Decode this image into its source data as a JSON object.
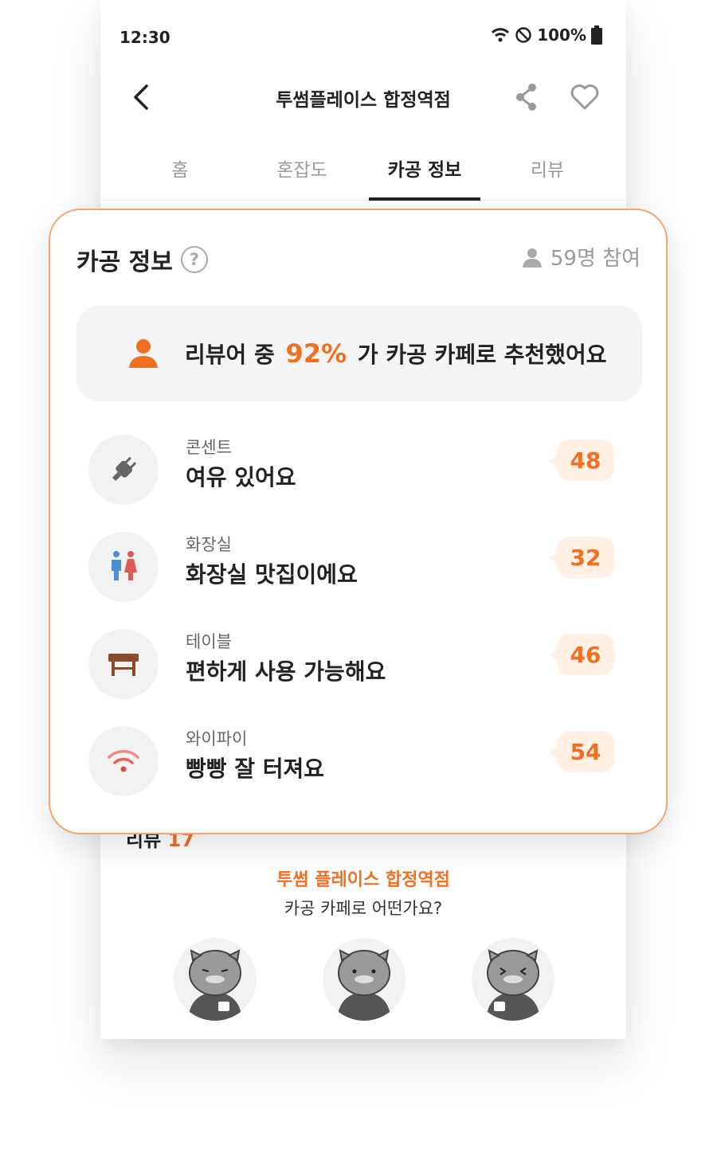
{
  "status": {
    "time": "12:30",
    "battery": "100%"
  },
  "header": {
    "title": "투썸플레이스 합정역점"
  },
  "tabs": [
    {
      "label": "홈",
      "active": false
    },
    {
      "label": "혼잡도",
      "active": false
    },
    {
      "label": "카공 정보",
      "active": true
    },
    {
      "label": "리뷰",
      "active": false
    }
  ],
  "card": {
    "title": "카공 정보",
    "help_icon": "question-circle-icon",
    "participants": "59명 참여",
    "summary": {
      "prefix": "리뷰어 중",
      "percent": "92%",
      "suffix": "가 카공 카페로 추천했어요"
    },
    "items": [
      {
        "category": "콘센트",
        "text": "여유 있어요",
        "count": "48",
        "icon": "plug-icon"
      },
      {
        "category": "화장실",
        "text": "화장실 맛집이에요",
        "count": "32",
        "icon": "restroom-icon"
      },
      {
        "category": "테이블",
        "text": "편하게 사용 가능해요",
        "count": "46",
        "icon": "table-icon"
      },
      {
        "category": "와이파이",
        "text": "빵빵 잘 터져요",
        "count": "54",
        "icon": "wifi-icon"
      }
    ]
  },
  "review_section": {
    "title_peek": "리뷰",
    "count_peek": "17",
    "place": "투썸 플레이스 합정역점",
    "question": "카공 카페로 어떤가요?",
    "options": [
      "thumbs-down-mascot",
      "neutral-mascot",
      "thumbs-up-mascot"
    ]
  },
  "colors": {
    "accent": "#f26f21",
    "card_border": "#f5a46b",
    "count_bg": "#fff0e3"
  }
}
